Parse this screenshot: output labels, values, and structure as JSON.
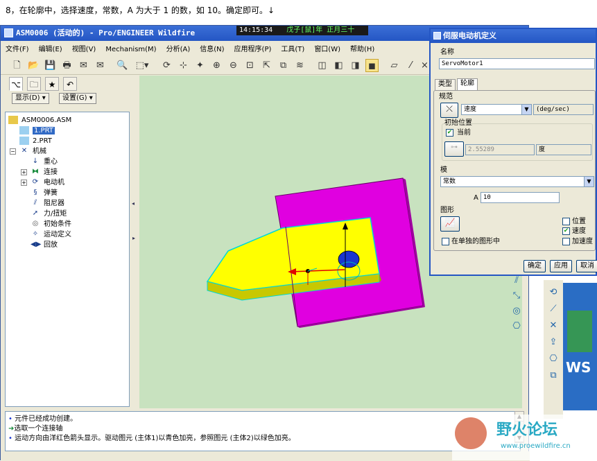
{
  "instruction": "8，在轮廓中，选择速度，常数，A 为大于 1 的数，如 10。确定即可。↓",
  "app": {
    "title": "ASM0006 (活动的) - Pro/ENGINEER Wildfire",
    "clock": "14:15:34",
    "date_text": "戊子[鼠]年 正月三十"
  },
  "menu": [
    "文件(F)",
    "编辑(E)",
    "视图(V)",
    "Mechanism(M)",
    "分析(A)",
    "信息(N)",
    "应用程序(P)",
    "工具(T)",
    "窗口(W)",
    "帮助(H)"
  ],
  "left_panel": {
    "show_label": "显示(D)",
    "settings_label": "设置(G)",
    "tree": [
      {
        "label": "ASM0006.ASM",
        "icon": "assembly-icon"
      },
      {
        "label": "1.PRT",
        "icon": "part-icon",
        "selected": true
      },
      {
        "label": "2.PRT",
        "icon": "part-icon"
      },
      {
        "label": "机械",
        "icon": "mechanism-icon"
      },
      {
        "label": "重心",
        "icon": "gravity-icon"
      },
      {
        "label": "连接",
        "icon": "connection-icon"
      },
      {
        "label": "电动机",
        "icon": "motor-icon"
      },
      {
        "label": "弹簧",
        "icon": "spring-icon"
      },
      {
        "label": "阻尼器",
        "icon": "damper-icon"
      },
      {
        "label": "力/扭矩",
        "icon": "force-icon"
      },
      {
        "label": "初始条件",
        "icon": "initial-condition-icon"
      },
      {
        "label": "运动定义",
        "icon": "motion-definition-icon"
      },
      {
        "label": "回放",
        "icon": "playback-icon"
      }
    ]
  },
  "messages": [
    "元件已经成功创建。",
    "选取一个连接轴",
    "运动方向由洋红色箭头显示。驱动图元 (主体1)以青色加亮，参照图元 (主体2)以绿色加亮。"
  ],
  "dialog": {
    "title": "伺服电动机定义",
    "name_label": "名称",
    "name_value": "ServoMotor1",
    "tabs": [
      "类型",
      "轮廓"
    ],
    "spec_label": "规范",
    "spec_value": "速度",
    "spec_unit": "(deg/sec)",
    "initpos_label": "初始位置",
    "current_label": "当前",
    "current_checked": true,
    "pos_value": "2.55289",
    "pos_unit": "度",
    "module_label": "模",
    "module_value": "常数",
    "a_label": "A",
    "a_value": "10",
    "graph_label": "图形",
    "separate_label": "在单独的图形中",
    "position_label": "位置",
    "velocity_label": "速度",
    "accel_label": "加速度",
    "position_checked": false,
    "velocity_checked": true,
    "accel_checked": false,
    "ok": "确定",
    "apply": "应用",
    "cancel": "取消"
  },
  "watermark": {
    "text": "野火论坛",
    "url": "www.proewildfire.cn"
  },
  "colors": {
    "titlebar": "#2456c4",
    "viewport": "#c8e2bf",
    "magenta_part": "#e000e0",
    "yellow_part": "#ffff00",
    "accent_cyan": "#00e5e5"
  }
}
